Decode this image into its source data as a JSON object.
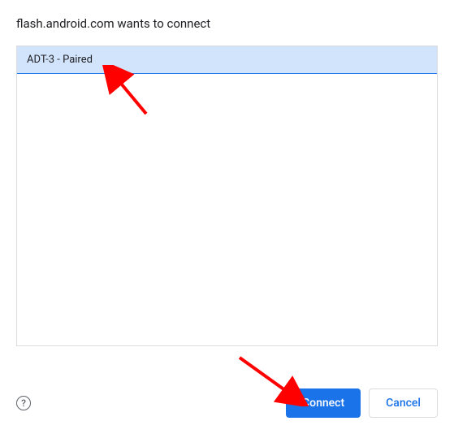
{
  "dialog": {
    "title": "flash.android.com wants to connect"
  },
  "devices": [
    {
      "label": "ADT-3 - Paired",
      "selected": true
    }
  ],
  "help": {
    "glyph": "?"
  },
  "buttons": {
    "connect": "Connect",
    "cancel": "Cancel"
  }
}
